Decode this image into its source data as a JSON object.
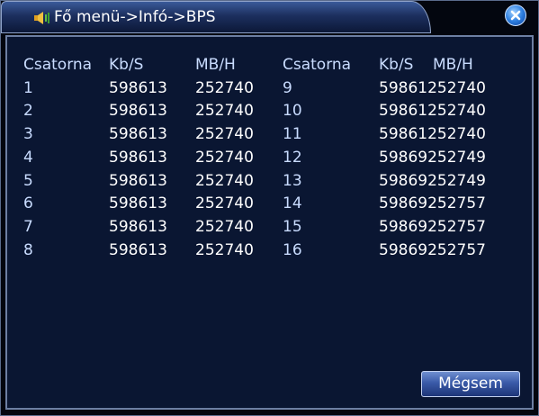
{
  "window": {
    "title": "Fő menü->Infó->BPS",
    "title_icon": "speaker-icon",
    "close_icon": "close-icon"
  },
  "table": {
    "headers_left": [
      "Csatorna",
      "Kb/S",
      "MB/H"
    ],
    "headers_right": [
      "Csatorna",
      "Kb/S",
      "MB/H"
    ],
    "rows_left": [
      {
        "channel": "1",
        "kbs": "598613",
        "mbh": "252740"
      },
      {
        "channel": "2",
        "kbs": "598613",
        "mbh": "252740"
      },
      {
        "channel": "3",
        "kbs": "598613",
        "mbh": "252740"
      },
      {
        "channel": "4",
        "kbs": "598613",
        "mbh": "252740"
      },
      {
        "channel": "5",
        "kbs": "598613",
        "mbh": "252740"
      },
      {
        "channel": "6",
        "kbs": "598613",
        "mbh": "252740"
      },
      {
        "channel": "7",
        "kbs": "598613",
        "mbh": "252740"
      },
      {
        "channel": "8",
        "kbs": "598613",
        "mbh": "252740"
      }
    ],
    "rows_right": [
      {
        "channel": "9",
        "combined": "59861252740"
      },
      {
        "channel": "10",
        "combined": "59861252740"
      },
      {
        "channel": "11",
        "combined": "59861252740"
      },
      {
        "channel": "12",
        "combined": "59869252749"
      },
      {
        "channel": "13",
        "combined": "59869252749"
      },
      {
        "channel": "14",
        "combined": "59869252757"
      },
      {
        "channel": "15",
        "combined": "59869252757"
      },
      {
        "channel": "16",
        "combined": "59869252757"
      }
    ]
  },
  "buttons": {
    "cancel_label": "Mégsem"
  },
  "colors": {
    "background": "#0a1632",
    "header_text": "#c9dcff",
    "value_text": "#ffffff"
  }
}
